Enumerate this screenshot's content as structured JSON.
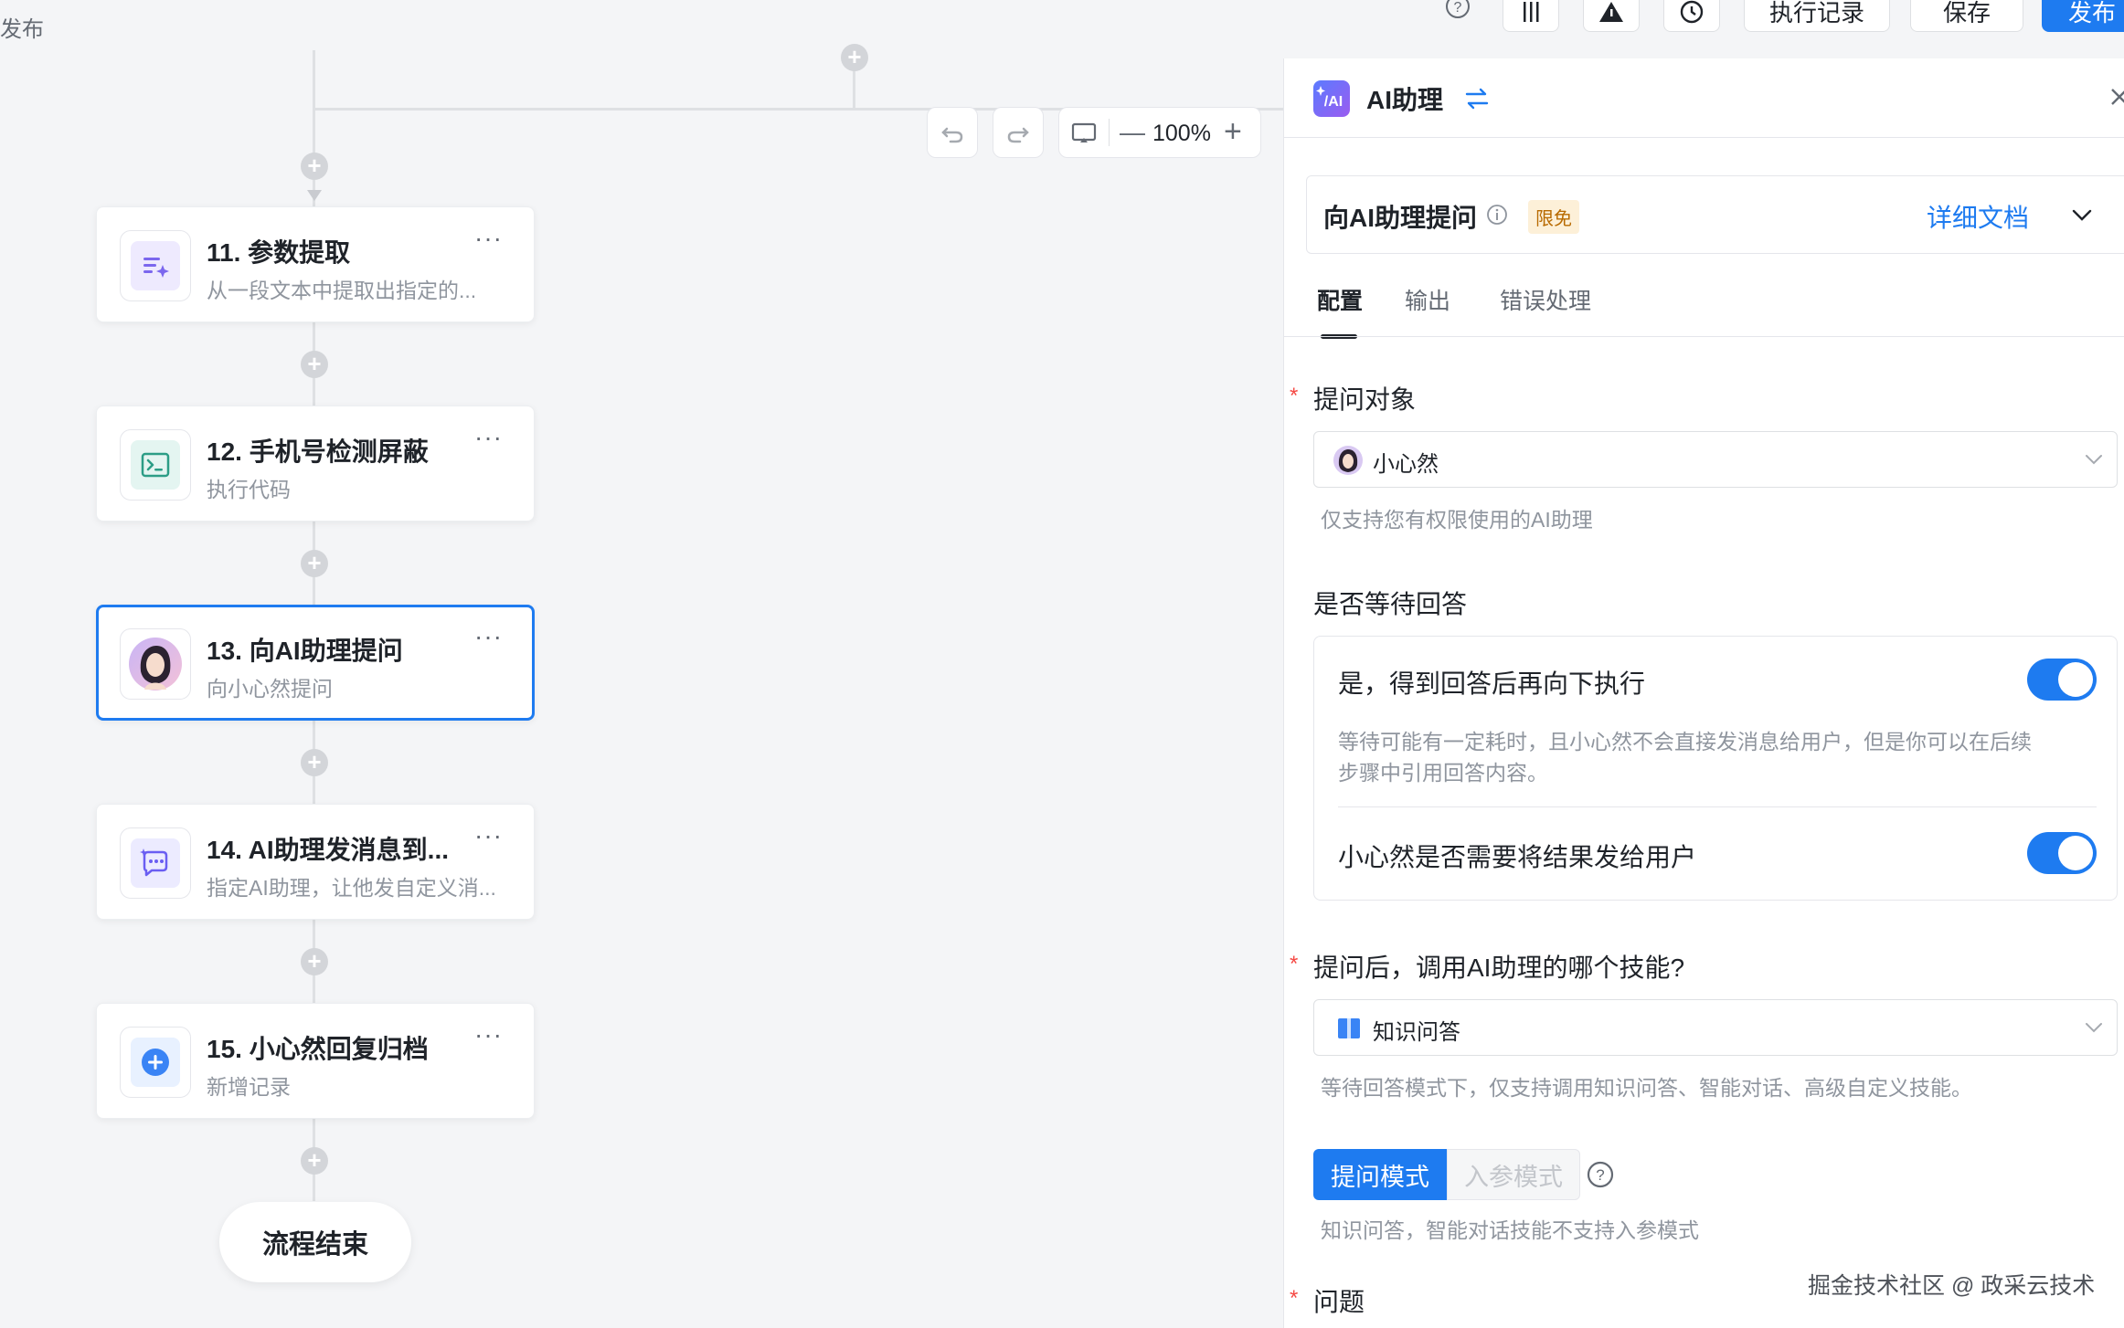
{
  "topbar": {
    "left_label": "发布",
    "run_history": "执行记录",
    "save": "保存",
    "publish": "发布"
  },
  "canvas": {
    "zoom": "100%",
    "nodes": [
      {
        "title": "11. 参数提取",
        "desc": "从一段文本中提取出指定的...",
        "icon": "sparkle-list-icon"
      },
      {
        "title": "12. 手机号检测屏蔽",
        "desc": "执行代码",
        "icon": "terminal-icon"
      },
      {
        "title": "13. 向AI助理提问",
        "desc": "向小心然提问",
        "icon": "avatar-icon"
      },
      {
        "title": "14. AI助理发消息到...",
        "desc": "指定AI助理，让他发自定义消...",
        "icon": "chat-sparkle-icon"
      },
      {
        "title": "15. 小心然回复归档",
        "desc": "新增记录",
        "icon": "plus-circle-icon"
      }
    ],
    "more_label": "···",
    "end_label": "流程结束"
  },
  "panel": {
    "title": "AI助理",
    "step_title": "向AI助理提问",
    "badge": "限免",
    "doc_link": "详细文档",
    "tabs": [
      "配置",
      "输出",
      "错误处理"
    ],
    "ask_target_label": "提问对象",
    "ask_target_value": "小心然",
    "ask_target_hint": "仅支持您有权限使用的AI助理",
    "wait_label": "是否等待回答",
    "wait_option_title": "是，得到回答后再向下执行",
    "wait_option_desc_1": "等待可能有一定耗时，且小心然不会直接发消息给用户，但是你可以在后续",
    "wait_option_desc_2": "步骤中引用回答内容。",
    "send_result_label": "小心然是否需要将结果发给用户",
    "skill_label": "提问后，调用AI助理的哪个技能?",
    "skill_value": "知识问答",
    "skill_hint": "等待回答模式下，仅支持调用知识问答、智能对话、高级自定义技能。",
    "mode_ask": "提问模式",
    "mode_param": "入参模式",
    "mode_hint": "知识问答，智能对话技能不支持入参模式",
    "question_label": "问题",
    "required_mark": "*"
  },
  "watermark": "掘金技术社区 @ 政采云技术",
  "colors": {
    "accent": "#1e7bf0",
    "required": "#f54a45",
    "badge_bg": "#fdf0d8",
    "badge_text": "#b86a00"
  }
}
